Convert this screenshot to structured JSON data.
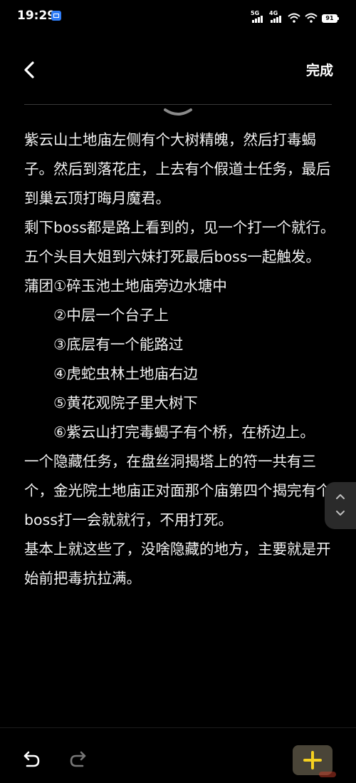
{
  "status_bar": {
    "time": "19:29",
    "network_1": "5G",
    "network_2": "4G",
    "battery": "91"
  },
  "header": {
    "done_label": "完成"
  },
  "note": {
    "lines": [
      "紫云山土地庙左侧有个大树精魄，然后打毒蝎子。然后到落花庄，上去有个假道士任务，最后到巢云顶打晦月魔君。",
      "剩下boss都是路上看到的，见一个打一个就行。",
      "五个头目大姐到六妹打死最后boss一起触发。",
      "蒲团①碎玉池土地庙旁边水塘中",
      "②中层一个台子上",
      "③底层有一个能路过",
      "④虎蛇虫林土地庙右边",
      "⑤黄花观院子里大树下",
      "⑥紫云山打完毒蝎子有个桥，在桥边上。",
      "一个隐藏任务，在盘丝洞揭塔上的符一共有三个，金光院土地庙正对面那个庙第四个揭完有个boss打一会就就行，不用打死。",
      "基本上就这些了，没啥隐藏的地方，主要就是开始前把毒抗拉满。"
    ]
  },
  "colors": {
    "background": "#000000",
    "text": "#f2f2f2",
    "add_button_bg": "#4a4538",
    "add_button_icon": "#f5d020",
    "redo_disabled": "#777777"
  },
  "icons": {
    "back": "chevron-left-icon",
    "collapse": "chevron-down-icon",
    "scroll_up": "chevron-up-icon",
    "scroll_down": "chevron-down-icon",
    "undo": "undo-icon",
    "redo": "redo-icon",
    "add": "plus-icon"
  }
}
